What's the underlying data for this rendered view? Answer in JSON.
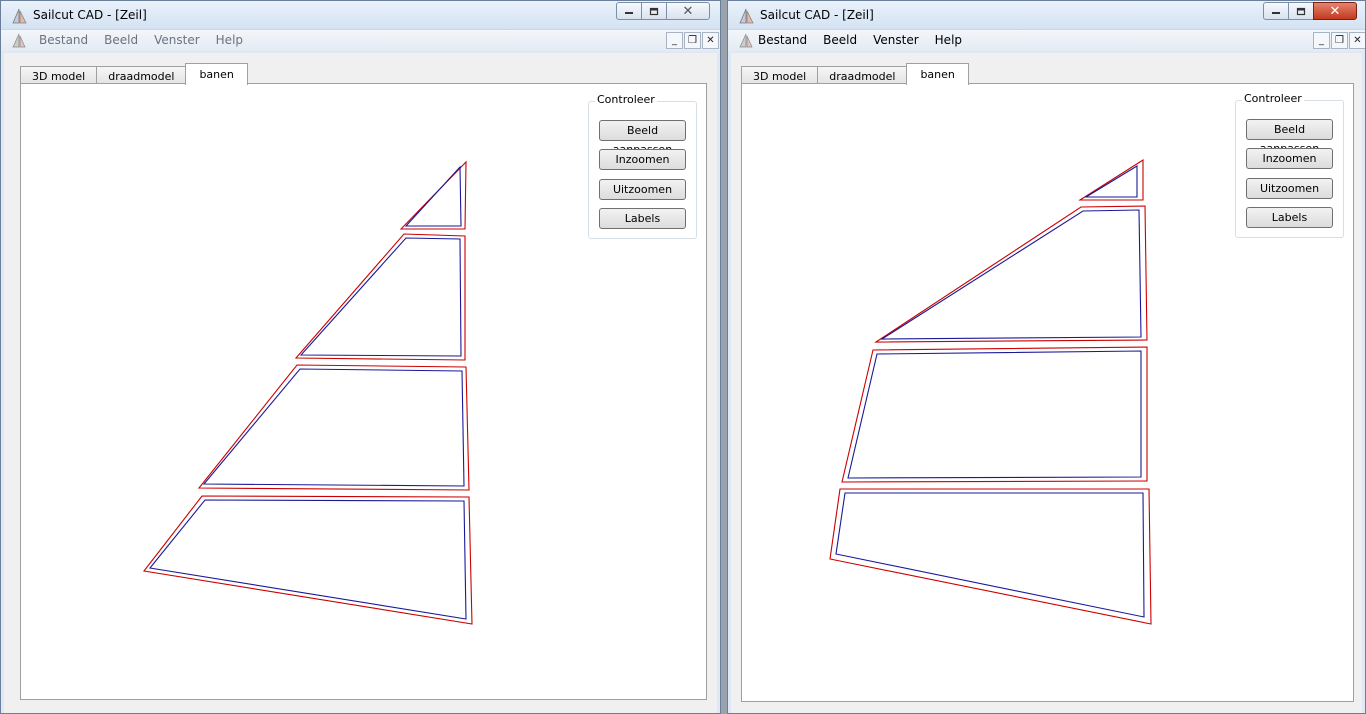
{
  "windows": [
    {
      "title": "Sailcut CAD - [Zeil]",
      "menu": [
        "Bestand",
        "Beeld",
        "Venster",
        "Help"
      ],
      "tabs": [
        "3D model",
        "draadmodel",
        "banen"
      ],
      "active_tab": "banen",
      "control_group": {
        "title": "Controleer",
        "buttons": [
          "Beeld aanpassen",
          "Inzoomen",
          "Uitzoomen",
          "Labels"
        ]
      }
    },
    {
      "title": "Sailcut CAD - [Zeil]",
      "menu": [
        "Bestand",
        "Beeld",
        "Venster",
        "Help"
      ],
      "tabs": [
        "3D model",
        "draadmodel",
        "banen"
      ],
      "active_tab": "banen",
      "control_group": {
        "title": "Controleer",
        "buttons": [
          "Beeld aanpassen",
          "Inzoomen",
          "Uitzoomen",
          "Labels"
        ]
      }
    }
  ],
  "caption_icons": [
    "minimize-icon",
    "restore-icon",
    "close-icon"
  ],
  "mdi_icons": [
    "mdi-minimize-icon",
    "mdi-restore-icon",
    "mdi-close-icon"
  ],
  "colors": {
    "panel_outline": "#cc0000",
    "panel_inner": "#1a1a99",
    "title_bar": "#dfe9f5",
    "close_button_active": "#c23a1f"
  }
}
